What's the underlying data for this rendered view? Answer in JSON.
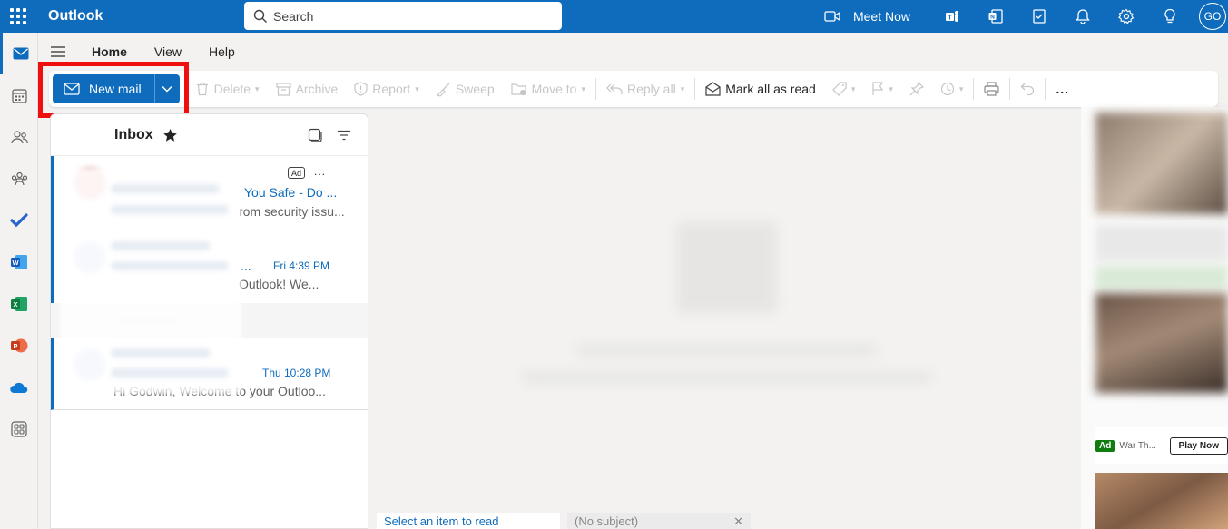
{
  "app": {
    "title": "Outlook",
    "brand_color": "#0f6cbd"
  },
  "search": {
    "placeholder": "Search"
  },
  "topbar": {
    "meet_now": "Meet Now",
    "avatar_initials": "GO"
  },
  "ribbon": {
    "tabs": [
      "Home",
      "View",
      "Help"
    ]
  },
  "toolbar": {
    "new_mail": "New mail",
    "delete": "Delete",
    "archive": "Archive",
    "report": "Report",
    "sweep": "Sweep",
    "move_to": "Move to",
    "reply_all": "Reply all",
    "mark_all_read": "Mark all as read",
    "more": "..."
  },
  "inbox": {
    "title": "Inbox",
    "messages": [
      {
        "subject": "You Safe - Do ...",
        "preview": "rom security issu...",
        "badge": "Ad",
        "more": "..."
      },
      {
        "subject": "...",
        "preview": "Outlook! We...",
        "time": "Fri 4:39 PM"
      },
      {
        "preview": "Hi Godwin, Welcome to your Outloo...",
        "time": "Thu 10:28 PM"
      }
    ]
  },
  "reading_pane": {
    "tab_select": "Select an item to read",
    "tab_draft": "(No subject)"
  },
  "ad": {
    "badge": "Ad",
    "name": "War Th...",
    "cta": "Play Now"
  }
}
